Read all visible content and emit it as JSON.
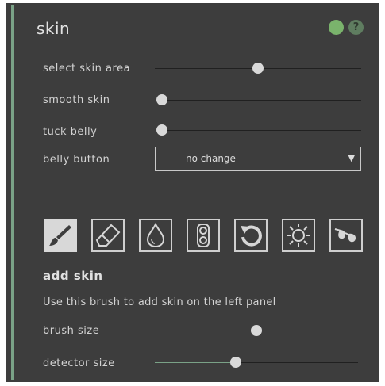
{
  "panel": {
    "title": "skin",
    "status_color": "#7ab36c",
    "help_label": "?",
    "accent_color": "#7aa287"
  },
  "controls": {
    "select_skin_area": {
      "label": "select skin area",
      "value": 0.5
    },
    "smooth_skin": {
      "label": "smooth skin",
      "value": 0.0
    },
    "tuck_belly": {
      "label": "tuck belly",
      "value": 0.0
    },
    "belly_button": {
      "label": "belly button",
      "selected": "no change"
    }
  },
  "tools": {
    "items": [
      {
        "name": "add-skin-brush",
        "icon": "brush-icon",
        "active": true
      },
      {
        "name": "eraser",
        "icon": "eraser-icon",
        "active": false
      },
      {
        "name": "drop",
        "icon": "water-drop-icon",
        "active": false
      },
      {
        "name": "compact",
        "icon": "compact-powder-icon",
        "active": false
      },
      {
        "name": "reset",
        "icon": "undo-icon",
        "active": false
      },
      {
        "name": "sun",
        "icon": "sun-icon",
        "active": false
      },
      {
        "name": "glasses",
        "icon": "sunglasses-icon",
        "active": false
      }
    ],
    "active_title": "add skin",
    "active_description": "Use this brush to add skin on the left panel"
  },
  "brush": {
    "brush_size": {
      "label": "brush size",
      "value": 0.5
    },
    "detector_size": {
      "label": "detector size",
      "value": 0.4
    }
  }
}
